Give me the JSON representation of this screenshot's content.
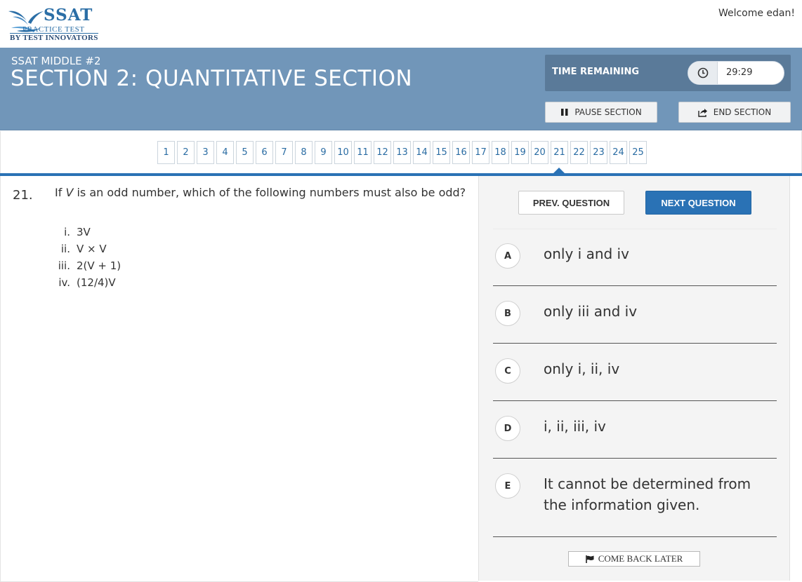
{
  "logo": {
    "title": "SSAT",
    "sub1": "PRACTICE TEST",
    "sub2": "BY TEST INNOVATORS"
  },
  "user": {
    "welcome": "Welcome edan!"
  },
  "header": {
    "test_name": "SSAT MIDDLE #2",
    "section_title": "SECTION 2: QUANTITATIVE SECTION",
    "timer_label": "TIME REMAINING",
    "timer_value": "29:29",
    "pause_label": "PAUSE SECTION",
    "end_label": "END SECTION",
    "colors": {
      "band": "#7196b9",
      "accent": "#2a72b5"
    }
  },
  "navigator": {
    "questions": [
      "1",
      "2",
      "3",
      "4",
      "5",
      "6",
      "7",
      "8",
      "9",
      "10",
      "11",
      "12",
      "13",
      "14",
      "15",
      "16",
      "17",
      "18",
      "19",
      "20",
      "21",
      "22",
      "23",
      "24",
      "25"
    ],
    "current": "21"
  },
  "question": {
    "number": "21.",
    "text_before": "If ",
    "variable": "V",
    "text_after": " is an odd number, which of the following numbers must also be odd?",
    "options": [
      {
        "num": "i.",
        "text": "3V"
      },
      {
        "num": "ii.",
        "text": "V × V"
      },
      {
        "num": "iii.",
        "text": "2(V + 1)"
      },
      {
        "num": "iv.",
        "text": "(12/4)V"
      }
    ]
  },
  "controls": {
    "prev_label": "PREV. QUESTION",
    "next_label": "NEXT QUESTION",
    "later_label": "COME BACK LATER"
  },
  "answers": [
    {
      "letter": "A",
      "text": "only i and iv"
    },
    {
      "letter": "B",
      "text": "only iii and iv"
    },
    {
      "letter": "C",
      "text": "only i, ii, iv"
    },
    {
      "letter": "D",
      "text": "i, ii, iii, iv"
    },
    {
      "letter": "E",
      "text": "It cannot be determined from the information given."
    }
  ]
}
